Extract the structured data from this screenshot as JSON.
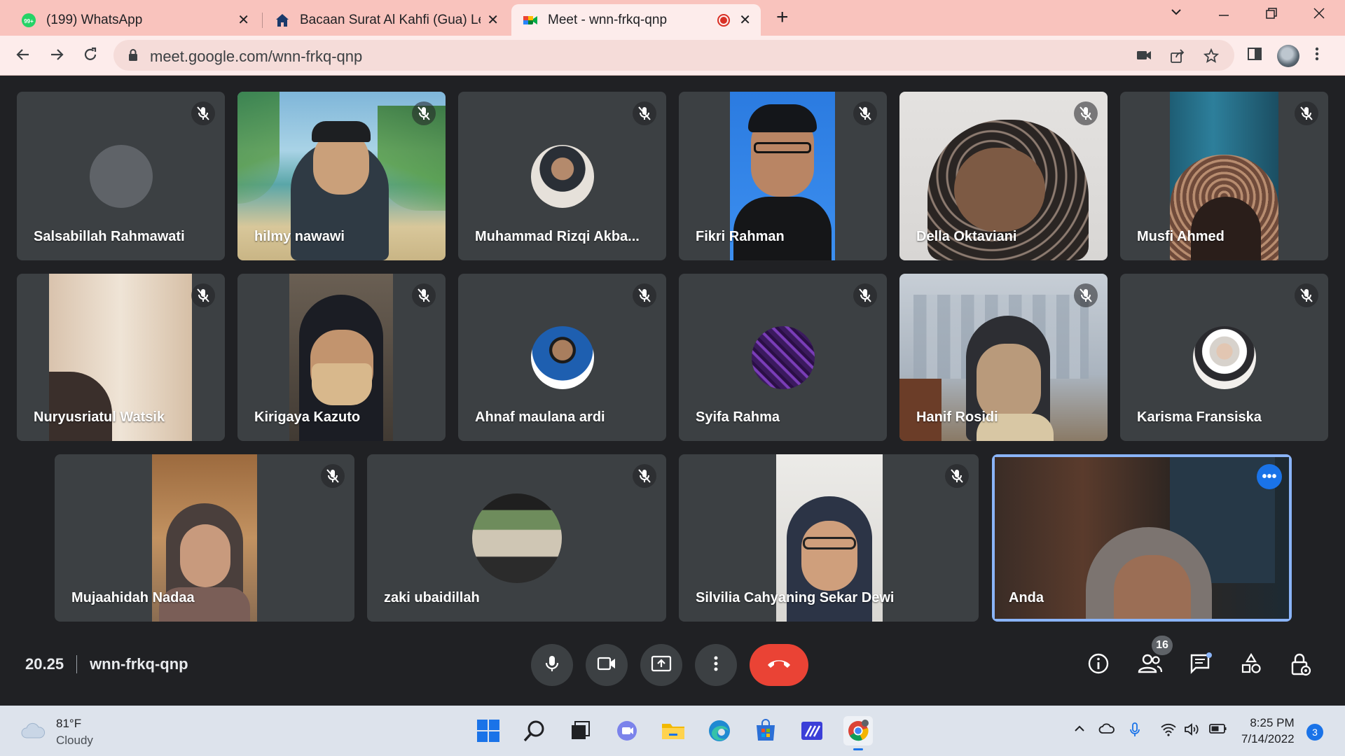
{
  "browser": {
    "tabs": [
      {
        "title": "(199) WhatsApp",
        "favicon": "whatsapp-icon",
        "badge": "99+"
      },
      {
        "title": "Bacaan Surat Al Kahfi (Gua) Lengkap",
        "favicon": "home-icon"
      },
      {
        "title": "Meet - wnn-frkq-qnp",
        "favicon": "google-meet-icon",
        "recording": true
      }
    ],
    "url": "meet.google.com/wnn-frkq-qnp"
  },
  "meeting": {
    "time": "20.25",
    "code": "wnn-frkq-qnp",
    "participant_count": "16"
  },
  "participants": [
    {
      "name": "Salsabillah Rahmawati",
      "muted": true
    },
    {
      "name": "hilmy nawawi",
      "muted": true
    },
    {
      "name": "Muhammad Rizqi Akba...",
      "muted": true
    },
    {
      "name": "Fikri Rahman",
      "muted": true
    },
    {
      "name": "Della Oktaviani",
      "muted": true
    },
    {
      "name": "Musfi Ahmed",
      "muted": true
    },
    {
      "name": "Nuryusriatul Watsik",
      "muted": true
    },
    {
      "name": "Kirigaya Kazuto",
      "muted": true
    },
    {
      "name": "Ahnaf maulana ardi",
      "muted": true
    },
    {
      "name": "Syifa Rahma",
      "muted": true
    },
    {
      "name": "Hanif Rosidi",
      "muted": true
    },
    {
      "name": "Karisma Fransiska",
      "muted": true
    },
    {
      "name": "Mujaahidah Nadaa",
      "muted": true
    },
    {
      "name": "zaki ubaidillah",
      "muted": true
    },
    {
      "name": "Silvilia Cahyaning Sekar Dewi",
      "muted": true
    },
    {
      "name": "Anda",
      "muted": false
    }
  ],
  "taskbar": {
    "temperature": "81°F",
    "condition": "Cloudy",
    "time": "8:25 PM",
    "date": "7/14/2022",
    "notifications": "3"
  },
  "colors": {
    "meet_background": "#202124",
    "tile_background": "#3c4043",
    "end_call": "#ea4335",
    "accent": "#1a73e8",
    "tab_strip": "#f9c3bd"
  }
}
